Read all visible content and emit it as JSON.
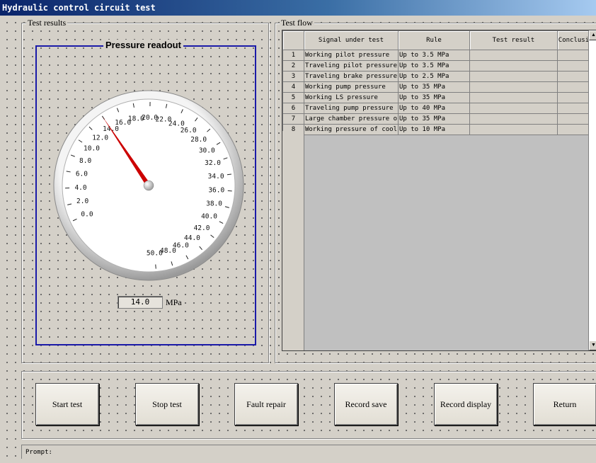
{
  "window": {
    "title": "Hydraulic control circuit test"
  },
  "results_group": {
    "legend": "Test results",
    "gauge_title": "Pressure readout",
    "gauge": {
      "min": 0,
      "max": 50,
      "value": 14.0,
      "tick_labels": [
        "0.0",
        "2.0",
        "4.0",
        "6.0",
        "8.0",
        "10.0",
        "12.0",
        "14.0",
        "16.0",
        "18.0",
        "20.0",
        "22.0",
        "24.0",
        "26.0",
        "28.0",
        "30.0",
        "32.0",
        "34.0",
        "36.0",
        "38.0",
        "40.0",
        "42.0",
        "44.0",
        "46.0",
        "48.0",
        "50.0"
      ],
      "needle_color": "#cc0000"
    },
    "readout_value": "14.0",
    "unit": "MPa"
  },
  "flow_group": {
    "legend": "Test flow",
    "columns": [
      "Signal under test",
      "Rule",
      "Test result",
      "Conclusion"
    ],
    "rows": [
      {
        "num": "1",
        "signal": "Working pilot pressure",
        "rule": "Up to 3.5 MPa",
        "result": "",
        "conclusion": ""
      },
      {
        "num": "2",
        "signal": "Traveling pilot pressure",
        "rule": "Up to 3.5 MPa",
        "result": "",
        "conclusion": ""
      },
      {
        "num": "3",
        "signal": "Traveling brake pressure",
        "rule": "Up to 2.5 MPa",
        "result": "",
        "conclusion": ""
      },
      {
        "num": "4",
        "signal": "Working pump pressure",
        "rule": "Up to 35 MPa",
        "result": "",
        "conclusion": ""
      },
      {
        "num": "5",
        "signal": "Working LS pressure",
        "rule": "Up to 35 MPa",
        "result": "",
        "conclusion": ""
      },
      {
        "num": "6",
        "signal": "Traveling pump pressure",
        "rule": "Up to 40 MPa",
        "result": "",
        "conclusion": ""
      },
      {
        "num": "7",
        "signal": "Large chamber pressure o",
        "rule": "Up to 35 MPa",
        "result": "",
        "conclusion": ""
      },
      {
        "num": "8",
        "signal": "Working pressure of cool",
        "rule": "Up to 10 MPa",
        "result": "",
        "conclusion": ""
      }
    ]
  },
  "buttons": {
    "start": "Start test",
    "stop": "Stop test",
    "fault": "Fault repair",
    "save": "Record save",
    "display": "Record display",
    "return": "Return"
  },
  "status": {
    "prompt_label": "Prompt:"
  }
}
